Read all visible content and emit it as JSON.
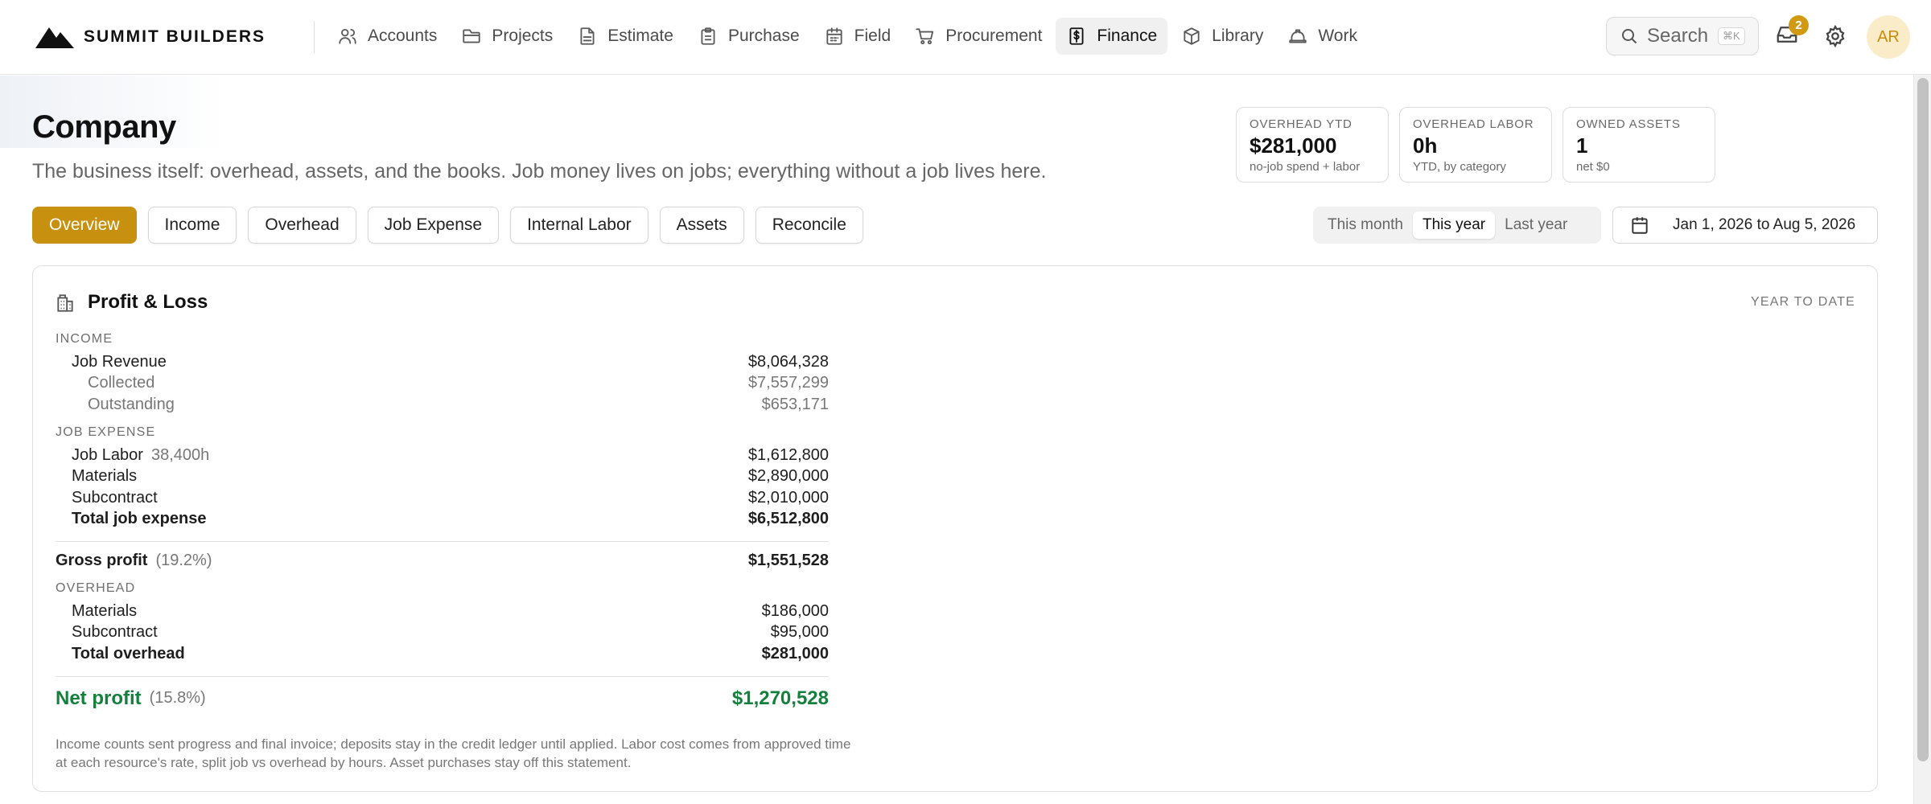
{
  "brand": {
    "name": "SUMMIT BUILDERS"
  },
  "nav": {
    "items": [
      {
        "label": "Accounts",
        "icon": "users-icon"
      },
      {
        "label": "Projects",
        "icon": "folder-icon"
      },
      {
        "label": "Estimate",
        "icon": "document-icon"
      },
      {
        "label": "Purchase",
        "icon": "clipboard-icon"
      },
      {
        "label": "Field",
        "icon": "calendar-icon"
      },
      {
        "label": "Procurement",
        "icon": "cart-icon"
      },
      {
        "label": "Finance",
        "icon": "dollar-icon",
        "active": true
      },
      {
        "label": "Library",
        "icon": "box-icon"
      },
      {
        "label": "Work",
        "icon": "hardhat-icon"
      }
    ],
    "search_label": "Search",
    "search_shortcut": "⌘K",
    "inbox_count": "2",
    "avatar_initials": "AR"
  },
  "header": {
    "title": "Company",
    "subtitle": "The business itself: overhead, assets, and the books. Job money lives on jobs; everything without a job lives here."
  },
  "stats": [
    {
      "label": "OVERHEAD YTD",
      "value": "$281,000",
      "sub": "no-job spend + labor"
    },
    {
      "label": "OVERHEAD LABOR",
      "value": "0h",
      "sub": "YTD, by category"
    },
    {
      "label": "OWNED ASSETS",
      "value": "1",
      "sub": "net $0"
    }
  ],
  "tabs": [
    {
      "label": "Overview",
      "active": true
    },
    {
      "label": "Income"
    },
    {
      "label": "Overhead"
    },
    {
      "label": "Job Expense"
    },
    {
      "label": "Internal Labor"
    },
    {
      "label": "Assets"
    },
    {
      "label": "Reconcile"
    }
  ],
  "period": {
    "options": [
      {
        "label": "This month"
      },
      {
        "label": "This year",
        "active": true
      },
      {
        "label": "Last year"
      }
    ],
    "range_label": "Jan 1, 2026 to Aug 5, 2026"
  },
  "pl": {
    "title": "Profit & Loss",
    "period": "YEAR TO DATE",
    "income": {
      "heading": "INCOME",
      "job_revenue": {
        "label": "Job Revenue",
        "amount": "$8,064,328"
      },
      "collected": {
        "label": "Collected",
        "amount": "$7,557,299"
      },
      "outstanding": {
        "label": "Outstanding",
        "amount": "$653,171"
      }
    },
    "job_expense": {
      "heading": "JOB EXPENSE",
      "labor": {
        "label": "Job Labor",
        "hours": "38,400h",
        "amount": "$1,612,800"
      },
      "materials": {
        "label": "Materials",
        "amount": "$2,890,000"
      },
      "subcontract": {
        "label": "Subcontract",
        "amount": "$2,010,000"
      },
      "total": {
        "label": "Total job expense",
        "amount": "$6,512,800"
      }
    },
    "gross_profit": {
      "label": "Gross profit",
      "pct": "(19.2%)",
      "amount": "$1,551,528"
    },
    "overhead": {
      "heading": "OVERHEAD",
      "materials": {
        "label": "Materials",
        "amount": "$186,000"
      },
      "subcontract": {
        "label": "Subcontract",
        "amount": "$95,000"
      },
      "total": {
        "label": "Total overhead",
        "amount": "$281,000"
      }
    },
    "net_profit": {
      "label": "Net profit",
      "pct": "(15.8%)",
      "amount": "$1,270,528"
    },
    "note": "Income counts sent progress and final invoice; deposits stay in the credit ledger until applied. Labor cost comes from approved time at each resource's rate, split job vs overhead by hours. Asset purchases stay off this statement."
  },
  "colors": {
    "accent": "#c8900f",
    "positive": "#15803d",
    "avatar_bg": "#fbecc9"
  }
}
